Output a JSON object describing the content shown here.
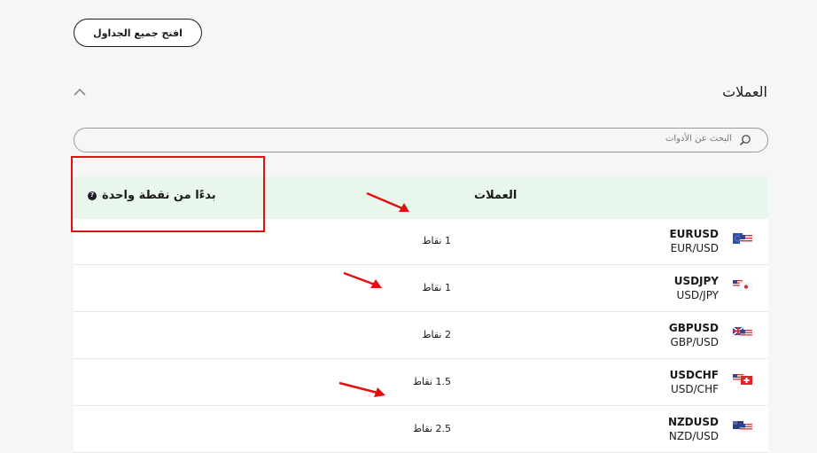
{
  "toolbar": {
    "open_all_label": "افتح جميع الجداول"
  },
  "section": {
    "title": "العملات"
  },
  "search": {
    "placeholder": "البحث عن الأدوات"
  },
  "table": {
    "headers": {
      "currencies": "العملات",
      "spread": "بدءًا من نقطة واحدة",
      "info": "?"
    },
    "rows": [
      {
        "symbol": "EURUSD",
        "pair": "EUR/USD",
        "spread": "1 نقاط",
        "flag": "eu-us-flag-icon"
      },
      {
        "symbol": "USDJPY",
        "pair": "USD/JPY",
        "spread": "1 نقاط",
        "flag": "us-jp-flag-icon"
      },
      {
        "symbol": "GBPUSD",
        "pair": "GBP/USD",
        "spread": "2 نقاط",
        "flag": "gb-us-flag-icon"
      },
      {
        "symbol": "USDCHF",
        "pair": "USD/CHF",
        "spread": "1.5 نقاط",
        "flag": "us-ch-flag-icon"
      },
      {
        "symbol": "NZDUSD",
        "pair": "NZD/USD",
        "spread": "2.5 نقاط",
        "flag": "nz-us-flag-icon"
      }
    ]
  },
  "annotations": {
    "color": "#e01010"
  }
}
